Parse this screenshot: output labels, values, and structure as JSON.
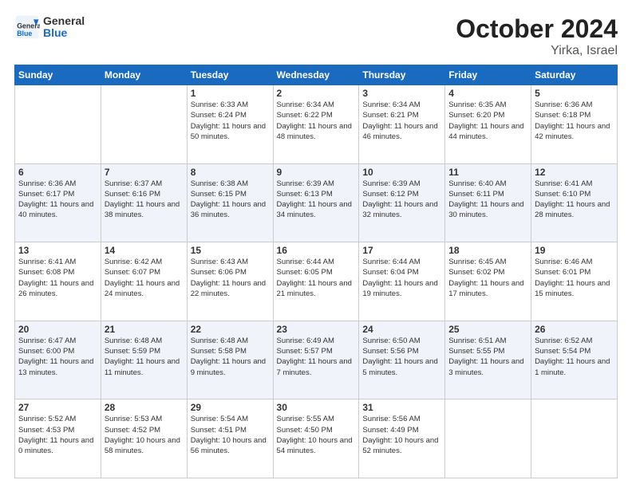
{
  "header": {
    "logo": {
      "line1": "General",
      "line2": "Blue"
    },
    "month": "October 2024",
    "location": "Yirka, Israel"
  },
  "days_of_week": [
    "Sunday",
    "Monday",
    "Tuesday",
    "Wednesday",
    "Thursday",
    "Friday",
    "Saturday"
  ],
  "weeks": [
    [
      {
        "day": "",
        "info": ""
      },
      {
        "day": "",
        "info": ""
      },
      {
        "day": "1",
        "info": "Sunrise: 6:33 AM\nSunset: 6:24 PM\nDaylight: 11 hours and 50 minutes."
      },
      {
        "day": "2",
        "info": "Sunrise: 6:34 AM\nSunset: 6:22 PM\nDaylight: 11 hours and 48 minutes."
      },
      {
        "day": "3",
        "info": "Sunrise: 6:34 AM\nSunset: 6:21 PM\nDaylight: 11 hours and 46 minutes."
      },
      {
        "day": "4",
        "info": "Sunrise: 6:35 AM\nSunset: 6:20 PM\nDaylight: 11 hours and 44 minutes."
      },
      {
        "day": "5",
        "info": "Sunrise: 6:36 AM\nSunset: 6:18 PM\nDaylight: 11 hours and 42 minutes."
      }
    ],
    [
      {
        "day": "6",
        "info": "Sunrise: 6:36 AM\nSunset: 6:17 PM\nDaylight: 11 hours and 40 minutes."
      },
      {
        "day": "7",
        "info": "Sunrise: 6:37 AM\nSunset: 6:16 PM\nDaylight: 11 hours and 38 minutes."
      },
      {
        "day": "8",
        "info": "Sunrise: 6:38 AM\nSunset: 6:15 PM\nDaylight: 11 hours and 36 minutes."
      },
      {
        "day": "9",
        "info": "Sunrise: 6:39 AM\nSunset: 6:13 PM\nDaylight: 11 hours and 34 minutes."
      },
      {
        "day": "10",
        "info": "Sunrise: 6:39 AM\nSunset: 6:12 PM\nDaylight: 11 hours and 32 minutes."
      },
      {
        "day": "11",
        "info": "Sunrise: 6:40 AM\nSunset: 6:11 PM\nDaylight: 11 hours and 30 minutes."
      },
      {
        "day": "12",
        "info": "Sunrise: 6:41 AM\nSunset: 6:10 PM\nDaylight: 11 hours and 28 minutes."
      }
    ],
    [
      {
        "day": "13",
        "info": "Sunrise: 6:41 AM\nSunset: 6:08 PM\nDaylight: 11 hours and 26 minutes."
      },
      {
        "day": "14",
        "info": "Sunrise: 6:42 AM\nSunset: 6:07 PM\nDaylight: 11 hours and 24 minutes."
      },
      {
        "day": "15",
        "info": "Sunrise: 6:43 AM\nSunset: 6:06 PM\nDaylight: 11 hours and 22 minutes."
      },
      {
        "day": "16",
        "info": "Sunrise: 6:44 AM\nSunset: 6:05 PM\nDaylight: 11 hours and 21 minutes."
      },
      {
        "day": "17",
        "info": "Sunrise: 6:44 AM\nSunset: 6:04 PM\nDaylight: 11 hours and 19 minutes."
      },
      {
        "day": "18",
        "info": "Sunrise: 6:45 AM\nSunset: 6:02 PM\nDaylight: 11 hours and 17 minutes."
      },
      {
        "day": "19",
        "info": "Sunrise: 6:46 AM\nSunset: 6:01 PM\nDaylight: 11 hours and 15 minutes."
      }
    ],
    [
      {
        "day": "20",
        "info": "Sunrise: 6:47 AM\nSunset: 6:00 PM\nDaylight: 11 hours and 13 minutes."
      },
      {
        "day": "21",
        "info": "Sunrise: 6:48 AM\nSunset: 5:59 PM\nDaylight: 11 hours and 11 minutes."
      },
      {
        "day": "22",
        "info": "Sunrise: 6:48 AM\nSunset: 5:58 PM\nDaylight: 11 hours and 9 minutes."
      },
      {
        "day": "23",
        "info": "Sunrise: 6:49 AM\nSunset: 5:57 PM\nDaylight: 11 hours and 7 minutes."
      },
      {
        "day": "24",
        "info": "Sunrise: 6:50 AM\nSunset: 5:56 PM\nDaylight: 11 hours and 5 minutes."
      },
      {
        "day": "25",
        "info": "Sunrise: 6:51 AM\nSunset: 5:55 PM\nDaylight: 11 hours and 3 minutes."
      },
      {
        "day": "26",
        "info": "Sunrise: 6:52 AM\nSunset: 5:54 PM\nDaylight: 11 hours and 1 minute."
      }
    ],
    [
      {
        "day": "27",
        "info": "Sunrise: 5:52 AM\nSunset: 4:53 PM\nDaylight: 11 hours and 0 minutes."
      },
      {
        "day": "28",
        "info": "Sunrise: 5:53 AM\nSunset: 4:52 PM\nDaylight: 10 hours and 58 minutes."
      },
      {
        "day": "29",
        "info": "Sunrise: 5:54 AM\nSunset: 4:51 PM\nDaylight: 10 hours and 56 minutes."
      },
      {
        "day": "30",
        "info": "Sunrise: 5:55 AM\nSunset: 4:50 PM\nDaylight: 10 hours and 54 minutes."
      },
      {
        "day": "31",
        "info": "Sunrise: 5:56 AM\nSunset: 4:49 PM\nDaylight: 10 hours and 52 minutes."
      },
      {
        "day": "",
        "info": ""
      },
      {
        "day": "",
        "info": ""
      }
    ]
  ]
}
